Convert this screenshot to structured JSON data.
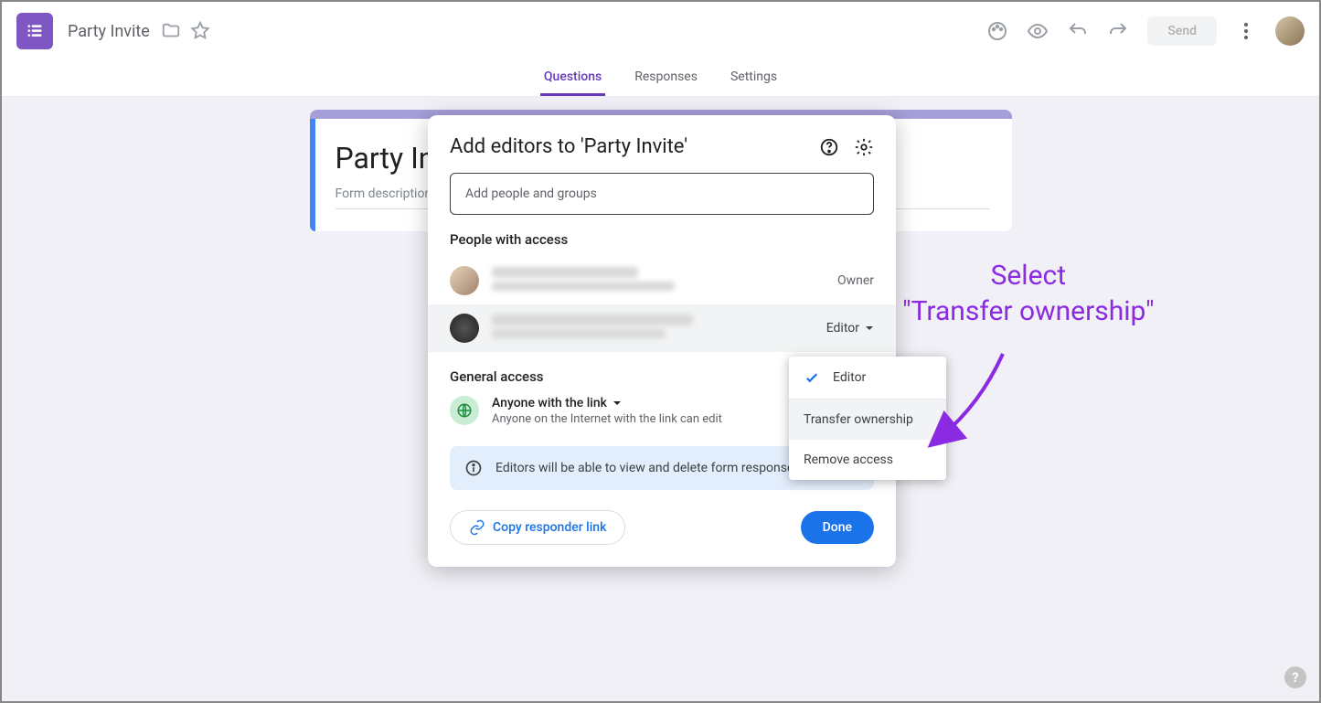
{
  "header": {
    "doc_title": "Party Invite",
    "send_label": "Send"
  },
  "tabs": {
    "questions": "Questions",
    "responses": "Responses",
    "settings": "Settings"
  },
  "form": {
    "title": "Party In",
    "description_placeholder": "Form description"
  },
  "modal": {
    "title": "Add editors to 'Party Invite'",
    "input_placeholder": "Add people and groups",
    "people_section": "People with access",
    "owner_label": "Owner",
    "editor_label": "Editor",
    "general_section": "General access",
    "link_scope": "Anyone with the link",
    "link_sub": "Anyone on the Internet with the link can edit",
    "banner": "Editors will be able to view and delete form responses",
    "copy_link": "Copy responder link",
    "done": "Done"
  },
  "dropdown": {
    "editor": "Editor",
    "transfer": "Transfer ownership",
    "remove": "Remove access"
  },
  "annotation": {
    "line1": "Select",
    "line2": "\"Transfer ownership\""
  }
}
